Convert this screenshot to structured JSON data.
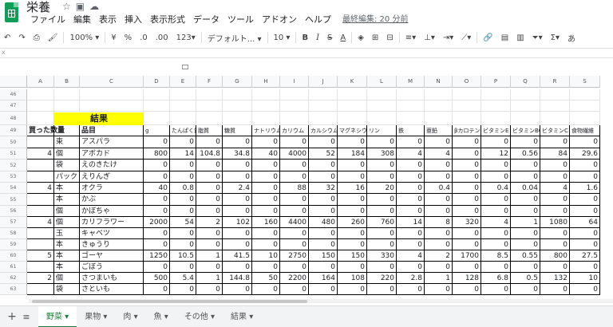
{
  "doc": {
    "title": "栄養",
    "icons": [
      "star-icon",
      "move-folder-icon",
      "cloud-status-icon"
    ]
  },
  "menu": [
    "ファイル",
    "編集",
    "表示",
    "挿入",
    "表示形式",
    "データ",
    "ツール",
    "アドオン",
    "ヘルプ"
  ],
  "last_edit": "最終編集: 20 分前",
  "toolbar": {
    "zoom": "100%",
    "currency": "¥",
    "percent": "%",
    "dec_less": ".0",
    "dec_more": ".00",
    "more_formats": "123",
    "font": "デフォルト...",
    "font_size": "10",
    "bold": "B",
    "italic": "I",
    "strike": "S",
    "text_color": "A",
    "sigma": "Σ",
    "trailing": "あ"
  },
  "formula_bar": {
    "label": "x"
  },
  "columns": [
    "A",
    "B",
    "C",
    "D",
    "E",
    "F",
    "G",
    "H",
    "I",
    "J",
    "K",
    "L",
    "M",
    "N",
    "O",
    "P",
    "Q",
    "R",
    "S"
  ],
  "rows": [
    {
      "n": "46"
    },
    {
      "n": "47"
    },
    {
      "n": "48"
    },
    {
      "n": "49"
    },
    {
      "n": "50"
    },
    {
      "n": "51"
    },
    {
      "n": "52"
    },
    {
      "n": "53"
    },
    {
      "n": "54"
    },
    {
      "n": "55"
    },
    {
      "n": "56"
    },
    {
      "n": "57"
    },
    {
      "n": "58"
    },
    {
      "n": "59"
    },
    {
      "n": "60"
    },
    {
      "n": "61"
    },
    {
      "n": "62"
    },
    {
      "n": "63"
    }
  ],
  "result_banner": "結果",
  "table_header": [
    "買った数量",
    "",
    "品目",
    "g",
    "たんぱく質",
    "脂質",
    "糖質",
    "ナトリウム",
    "カリウム",
    "カルシウム",
    "マグネシウム",
    "リン",
    "鉄",
    "亜鉛",
    "βカロテン",
    "ビタミンE",
    "ビタミンB6",
    "ビタミンC",
    "食物繊維"
  ],
  "table_rows": [
    [
      "",
      "束",
      "アスパラ",
      "0",
      "0",
      "0",
      "0",
      "0",
      "0",
      "0",
      "0",
      "0",
      "0",
      "0",
      "0",
      "0",
      "0",
      "0",
      "0"
    ],
    [
      "4",
      "個",
      "アボカド",
      "800",
      "14",
      "104.8",
      "34.8",
      "40",
      "4000",
      "52",
      "184",
      "308",
      "4",
      "4",
      "0",
      "12",
      "0.56",
      "84",
      "29.6"
    ],
    [
      "",
      "袋",
      "えのきたけ",
      "0",
      "0",
      "0",
      "0",
      "0",
      "0",
      "0",
      "0",
      "0",
      "0",
      "0",
      "0",
      "0",
      "0",
      "0",
      "0"
    ],
    [
      "",
      "パック",
      "えりんぎ",
      "0",
      "0",
      "0",
      "0",
      "0",
      "0",
      "0",
      "0",
      "0",
      "0",
      "0",
      "0",
      "0",
      "0",
      "0",
      "0"
    ],
    [
      "4",
      "本",
      "オクラ",
      "40",
      "0.8",
      "0",
      "2.4",
      "0",
      "88",
      "32",
      "16",
      "20",
      "0",
      "0.4",
      "0",
      "0.4",
      "0.04",
      "4",
      "1.6"
    ],
    [
      "",
      "本",
      "かぶ",
      "0",
      "0",
      "0",
      "0",
      "0",
      "0",
      "0",
      "0",
      "0",
      "0",
      "0",
      "0",
      "0",
      "0",
      "0",
      "0"
    ],
    [
      "",
      "個",
      "かぼちゃ",
      "0",
      "0",
      "0",
      "0",
      "0",
      "0",
      "0",
      "0",
      "0",
      "0",
      "0",
      "0",
      "0",
      "0",
      "0",
      "0"
    ],
    [
      "4",
      "個",
      "カリフラワー",
      "2000",
      "54",
      "2",
      "102",
      "160",
      "4400",
      "480",
      "260",
      "760",
      "14",
      "8",
      "320",
      "4",
      "1",
      "1080",
      "64"
    ],
    [
      "",
      "玉",
      "キャベツ",
      "0",
      "0",
      "0",
      "0",
      "0",
      "0",
      "0",
      "0",
      "0",
      "0",
      "0",
      "0",
      "0",
      "0",
      "0",
      "0"
    ],
    [
      "",
      "本",
      "きゅうり",
      "0",
      "0",
      "0",
      "0",
      "0",
      "0",
      "0",
      "0",
      "0",
      "0",
      "0",
      "0",
      "0",
      "0",
      "0",
      "0"
    ],
    [
      "5",
      "本",
      "ゴーヤ",
      "1250",
      "10.5",
      "1",
      "41.5",
      "10",
      "2750",
      "150",
      "150",
      "330",
      "4",
      "2",
      "1700",
      "8.5",
      "0.55",
      "800",
      "27.5"
    ],
    [
      "",
      "本",
      "ごぼう",
      "0",
      "0",
      "0",
      "0",
      "0",
      "0",
      "0",
      "0",
      "0",
      "0",
      "0",
      "0",
      "0",
      "0",
      "0",
      "0"
    ],
    [
      "2",
      "個",
      "さつまいも",
      "500",
      "5.4",
      "1",
      "144.8",
      "50",
      "2200",
      "164",
      "108",
      "220",
      "2.8",
      "1",
      "128",
      "6.8",
      "0.5",
      "132",
      "10"
    ],
    [
      "",
      "袋",
      "さといも",
      "0",
      "0",
      "0",
      "0",
      "0",
      "0",
      "0",
      "0",
      "0",
      "0",
      "0",
      "0",
      "0",
      "0",
      "0",
      "0"
    ]
  ],
  "sheet_tabs": [
    {
      "label": "野菜",
      "active": true
    },
    {
      "label": "果物",
      "active": false
    },
    {
      "label": "肉",
      "active": false
    },
    {
      "label": "魚",
      "active": false
    },
    {
      "label": "その他",
      "active": false
    },
    {
      "label": "結果",
      "active": false
    }
  ]
}
